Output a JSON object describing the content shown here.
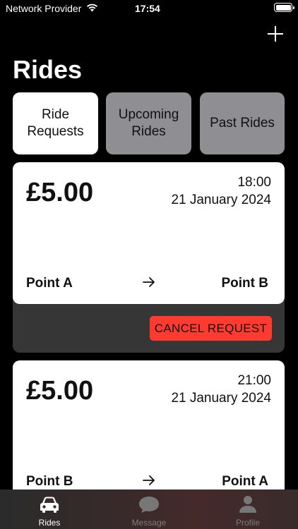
{
  "status_bar": {
    "carrier": "Network Provider",
    "time": "17:54"
  },
  "header": {
    "title": "Rides",
    "add_icon": "plus-icon"
  },
  "segments": [
    {
      "label": "Ride Requests",
      "selected": true
    },
    {
      "label": "Upcoming Rides",
      "selected": false
    },
    {
      "label": "Past Rides",
      "selected": false
    }
  ],
  "rides": [
    {
      "price": "£5.00",
      "time": "18:00",
      "date": "21 January 2024",
      "from": "Point A",
      "to": "Point B",
      "action": "CANCEL REQUEST"
    },
    {
      "price": "£5.00",
      "time": "21:00",
      "date": "21 January 2024",
      "from": "Point B",
      "to": "Point A"
    }
  ],
  "tab_bar": [
    {
      "label": "Rides",
      "icon": "car-icon",
      "selected": true
    },
    {
      "label": "Message",
      "icon": "message-bubble-icon",
      "selected": false
    },
    {
      "label": "Profile",
      "icon": "person-icon",
      "selected": false
    }
  ],
  "colors": {
    "background": "#000000",
    "card": "#ffffff",
    "segment_inactive": "#8e8e93",
    "cancel": "#ff3b30",
    "panel": "#363636"
  }
}
